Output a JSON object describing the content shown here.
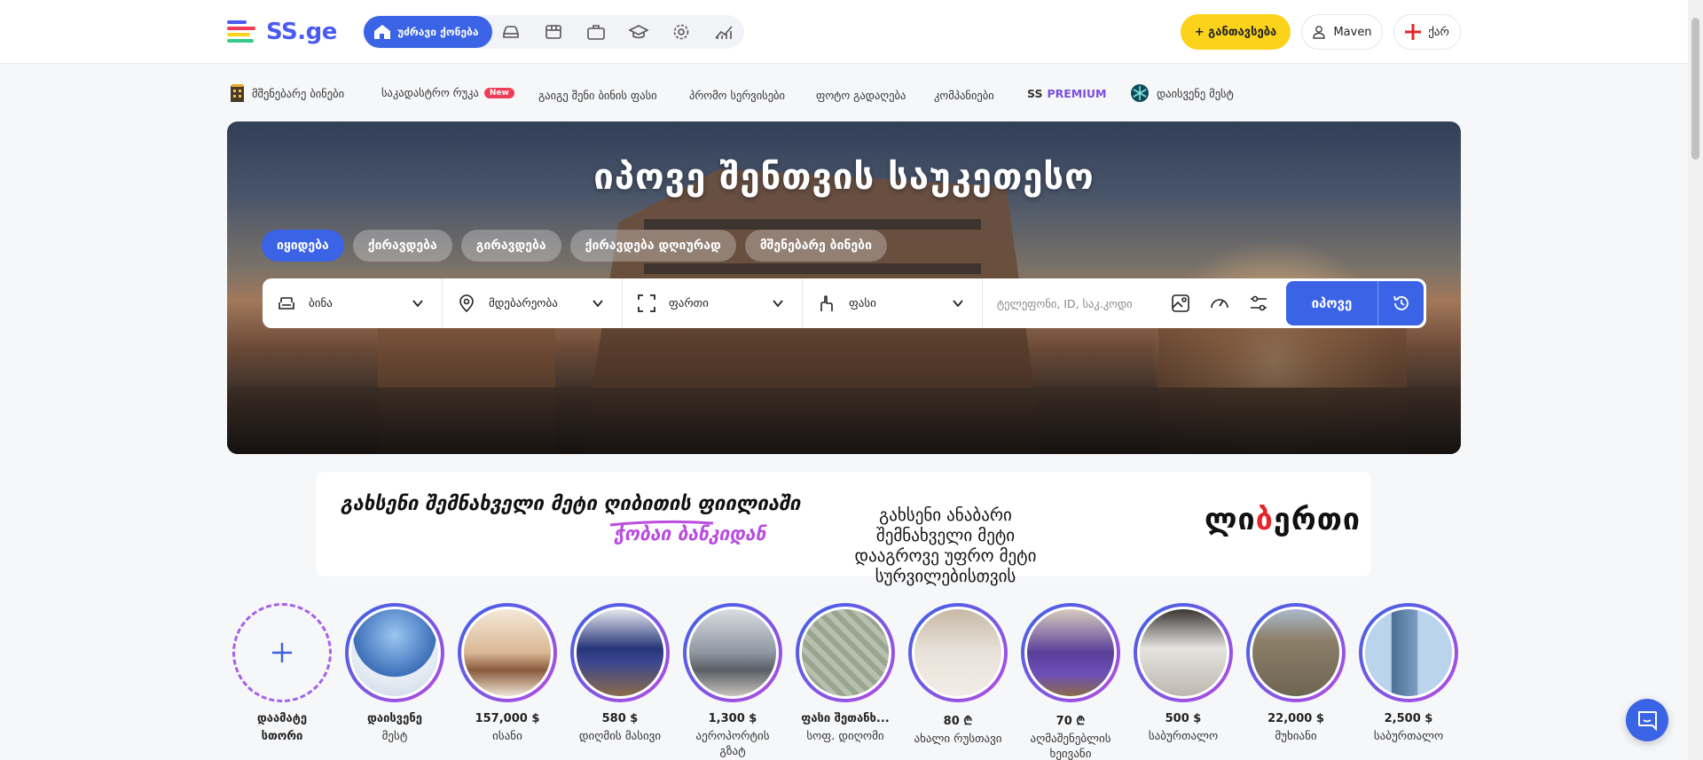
{
  "header": {
    "logo_text": "SS.ge",
    "active_category": "უძრავი ქონება",
    "category_icons": [
      "house-icon",
      "car-icon",
      "store-icon",
      "briefcase-icon",
      "graduation-cap-icon",
      "gear-icon",
      "chart-icon"
    ],
    "add_listing": "+ განთავსება",
    "user": "Maven",
    "language": "ქარ"
  },
  "subnav": {
    "items": [
      {
        "label": "მშენებარე ბინები",
        "icon": "building-icon"
      },
      {
        "label": "საკადასტრო რუკა",
        "badge": "New"
      },
      {
        "label": "გაიგე შენი ბინის ფასი"
      },
      {
        "label": "პრომო სერვისები"
      },
      {
        "label": "ფოტო გადაღება"
      },
      {
        "label": "კომპანიები"
      },
      {
        "label": "SS",
        "label_accent": "PREMIUM"
      },
      {
        "label": "დაისვენე მესტ",
        "icon": "snowflake-icon"
      }
    ]
  },
  "hero": {
    "title": "იპოვე შენთვის საუკეთესო",
    "tabs": [
      "იყიდება",
      "ქირავდება",
      "გირავდება",
      "ქირავდება დღიურად",
      "მშენებარე ბინები"
    ],
    "fields": [
      {
        "label": "ბინა",
        "icon": "sofa-icon"
      },
      {
        "label": "მდებარეობა",
        "icon": "location-pin-icon"
      },
      {
        "label": "ფართი",
        "icon": "area-expand-icon"
      },
      {
        "label": "ფასი",
        "icon": "price-hand-icon"
      }
    ],
    "search_placeholder": "ტელეფონი, ID, საკ.კოდი",
    "search_button": "იპოვე"
  },
  "banner": {
    "line1": "გახსენი შემნახველი მეტი ღიბითის ფიილიაში",
    "line2": "ჭობაი ბანკიდან",
    "line3": "გახსენი ანაბარი შემნახველი მეტი",
    "line4": "დააგროვე უფრო მეტი სურვილებისთვის",
    "brand_part1": "ლი",
    "brand_accent": "ბ",
    "brand_part2": "ერთი",
    "colors": {
      "brand_accent": "#e2262b",
      "script_purple": "#b84de0"
    }
  },
  "stories": [
    {
      "value": "დაამატე",
      "sub": "სთორი",
      "type": "add"
    },
    {
      "value": "დაისვენე",
      "sub": "მესტ",
      "photo": "snow-mountain"
    },
    {
      "value": "157,000 $",
      "sub": "ისანი",
      "photo": "bedroom-warm"
    },
    {
      "value": "580 $",
      "sub": "დიღმის მასივი",
      "photo": "bedroom-blue"
    },
    {
      "value": "1,300 $",
      "sub": "აეროპორტის გზატ",
      "photo": "living-room"
    },
    {
      "value": "ფასი შეთანხ...",
      "sub": "სოფ. დიღომი",
      "photo": "land-map"
    },
    {
      "value": "80 ₾",
      "sub": "ახალი რუსთავი",
      "photo": "bedroom-plain"
    },
    {
      "value": "70 ₾",
      "sub": "აღმაშენებლის ხეივანი",
      "photo": "bedroom-purple"
    },
    {
      "value": "500 $",
      "sub": "საბურთალო",
      "photo": "kitchen"
    },
    {
      "value": "22,000 $",
      "sub": "მუხიანი",
      "photo": "city-view"
    },
    {
      "value": "2,500 $",
      "sub": "საბურთალო",
      "photo": "tower"
    }
  ],
  "colors": {
    "primary": "#3a63e6",
    "accent_yellow": "#fbd31b",
    "new_badge": "#ef3d57",
    "premium": "#7a4fe0"
  }
}
